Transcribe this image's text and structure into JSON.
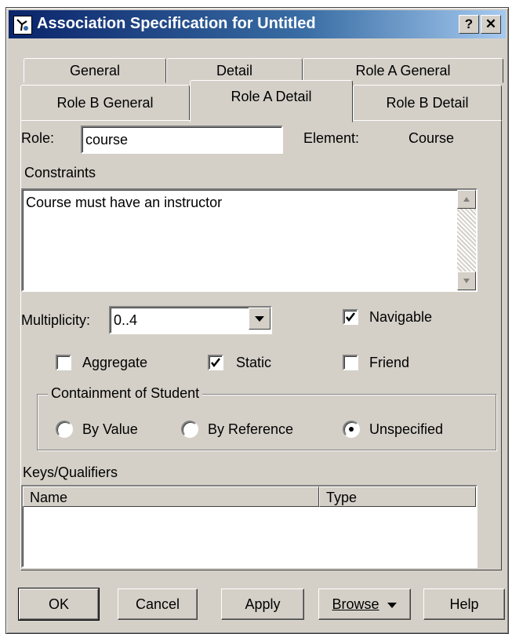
{
  "window": {
    "title": "Association Specification for Untitled",
    "help_label": "?",
    "close_label": "✕"
  },
  "tabs": {
    "back": [
      "General",
      "Detail",
      "Role A General"
    ],
    "front": [
      "Role B General",
      "Role A Detail",
      "Role B Detail"
    ],
    "active": "Role A Detail"
  },
  "role": {
    "label": "Role:",
    "value": "course",
    "element_label": "Element:",
    "element_value": "Course"
  },
  "constraints": {
    "label": "Constraints",
    "text": "Course must have an instructor"
  },
  "multiplicity": {
    "label": "Multiplicity:",
    "value": "0..4"
  },
  "checkboxes": {
    "navigable": {
      "label": "Navigable",
      "checked": true
    },
    "aggregate": {
      "label": "Aggregate",
      "checked": false
    },
    "static": {
      "label": "Static",
      "checked": true
    },
    "friend": {
      "label": "Friend",
      "checked": false
    }
  },
  "containment": {
    "title": "Containment of Student",
    "options": [
      {
        "label": "By Value",
        "selected": false
      },
      {
        "label": "By Reference",
        "selected": false
      },
      {
        "label": "Unspecified",
        "selected": true
      }
    ]
  },
  "keys": {
    "label": "Keys/Qualifiers",
    "columns": [
      "Name",
      "Type"
    ]
  },
  "buttons": {
    "ok": "OK",
    "cancel": "Cancel",
    "apply": "Apply",
    "browse": "Browse",
    "help": "Help"
  }
}
